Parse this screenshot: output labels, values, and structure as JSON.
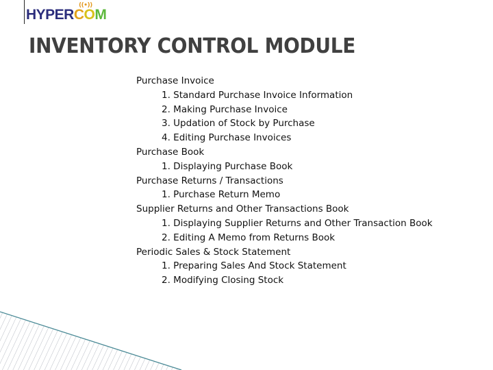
{
  "logo": {
    "text_main": "HYPER",
    "text_c": "C",
    "text_o": "O",
    "text_m": "M",
    "signal_glyph": "((•))",
    "colors": {
      "main": "#2b2d7c",
      "c": "#e3a21a",
      "o": "#d7c21b",
      "m": "#5cb83b"
    }
  },
  "title": "INVENTORY CONTROL MODULE",
  "sections": [
    {
      "heading": "Purchase Invoice",
      "items": [
        "1. Standard Purchase Invoice Information",
        "2. Making Purchase Invoice",
        "3. Updation of Stock by Purchase",
        "4. Editing Purchase Invoices"
      ]
    },
    {
      "heading": "Purchase Book",
      "items": [
        "1. Displaying Purchase Book"
      ]
    },
    {
      "heading": "Purchase Returns / Transactions",
      "items": [
        "1. Purchase Return Memo"
      ]
    },
    {
      "heading": "Supplier Returns and Other Transactions Book",
      "items": [
        "1. Displaying Supplier Returns and Other Transaction Book",
        "2. Editing A Memo from Returns Book"
      ]
    },
    {
      "heading": "Periodic Sales & Stock Statement",
      "items": [
        "1. Preparing Sales And Stock Statement",
        "2. Modifying Closing Stock"
      ]
    }
  ],
  "decoration": {
    "line_color": "#4a8a96",
    "hatch_color": "#b8bcc4"
  }
}
